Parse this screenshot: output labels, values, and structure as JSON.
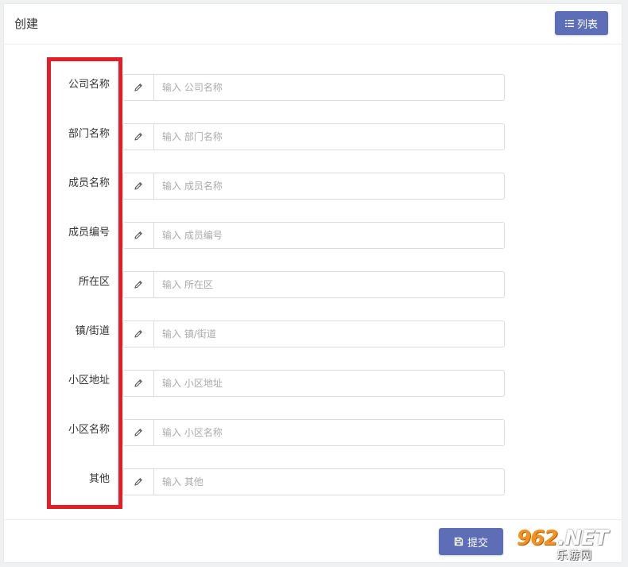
{
  "header": {
    "title": "创建",
    "list_button_label": "列表",
    "list_button_icon": "list-icon"
  },
  "form": {
    "addon_icon": "pencil-icon",
    "fields": [
      {
        "label": "公司名称",
        "placeholder": "输入 公司名称",
        "value": ""
      },
      {
        "label": "部门名称",
        "placeholder": "输入 部门名称",
        "value": ""
      },
      {
        "label": "成员名称",
        "placeholder": "输入 成员名称",
        "value": ""
      },
      {
        "label": "成员编号",
        "placeholder": "输入 成员编号",
        "value": ""
      },
      {
        "label": "所在区",
        "placeholder": "输入 所在区",
        "value": ""
      },
      {
        "label": "镇/街道",
        "placeholder": "输入 镇/街道",
        "value": ""
      },
      {
        "label": "小区地址",
        "placeholder": "输入 小区地址",
        "value": ""
      },
      {
        "label": "小区名称",
        "placeholder": "输入 小区名称",
        "value": ""
      },
      {
        "label": "其他",
        "placeholder": "输入 其他",
        "value": ""
      }
    ]
  },
  "footer": {
    "submit_label": "提交",
    "submit_icon": "save-icon"
  },
  "watermark": {
    "number": "962",
    "suffix": ".NET",
    "subtitle": "乐游网"
  },
  "colors": {
    "primary": "#5d6eb6",
    "highlight": "#e41e26",
    "background": "#f0f1f3"
  }
}
